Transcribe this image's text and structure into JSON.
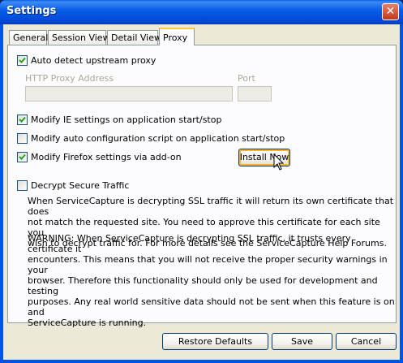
{
  "window": {
    "title": "Settings",
    "close_glyph": "✕"
  },
  "tabs": [
    {
      "label": "General"
    },
    {
      "label": "Session View"
    },
    {
      "label": "Detail View"
    },
    {
      "label": "Proxy"
    }
  ],
  "proxy": {
    "auto_detect": {
      "label": "Auto detect upstream proxy",
      "checked": true
    },
    "http_proxy_address": {
      "label": "HTTP Proxy Address",
      "value": ""
    },
    "port": {
      "label": "Port",
      "value": ""
    },
    "modify_ie": {
      "label": "Modify IE settings on application start/stop",
      "checked": true
    },
    "modify_autoconfig": {
      "label": "Modify auto configuration script on application start/stop",
      "checked": false
    },
    "modify_firefox": {
      "label": "Modify Firefox settings via add-on",
      "checked": true
    },
    "install_now": "Install Now",
    "decrypt": {
      "label": "Decrypt Secure Traffic",
      "checked": false
    },
    "description_lines": [
      "When ServiceCapture is decrypting SSL traffic it will return its own certificate that does",
      "not match the requested site.  You need to approve this certificate for each site you",
      "wish to decrypt traffic for.  For more details see the ServiceCapture Help Forums."
    ],
    "warning_lines": [
      "WARNING: When ServiceCapture is decrypting SSL traffic, it trusts every certificate it",
      "encounters.  This means that you will not receive the proper security warnings in your",
      "browser.  Therefore this functionality should only be used for development and testing",
      "purposes.  Any real world sensitive data should not be sent when this feature is on and",
      "ServiceCapture is running."
    ]
  },
  "footer": {
    "restore_defaults": "Restore Defaults",
    "save": "Save",
    "cancel": "Cancel"
  },
  "colors": {
    "titlebar": "#0054e3",
    "dialog_bg": "#ece9d8",
    "tab_active_accent": "#ffc83c",
    "check": "#21a121"
  }
}
